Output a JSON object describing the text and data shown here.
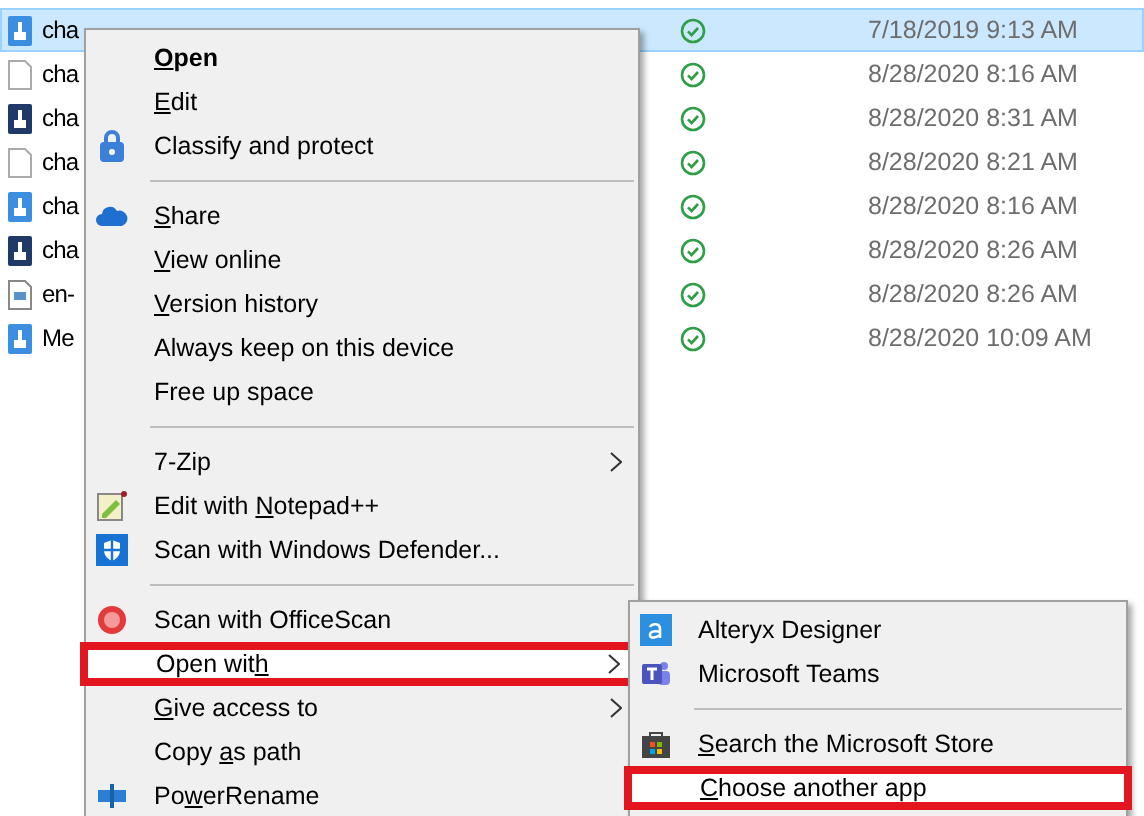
{
  "files": [
    {
      "name": "cha",
      "kind": "bluedoc",
      "synced": true,
      "modified": "7/18/2019 9:13 AM",
      "selected": true
    },
    {
      "name": "cha",
      "kind": "blank",
      "synced": true,
      "modified": "8/28/2020 8:16 AM",
      "selected": false
    },
    {
      "name": "cha",
      "kind": "darkdoc",
      "synced": true,
      "modified": "8/28/2020 8:31 AM",
      "selected": false
    },
    {
      "name": "cha",
      "kind": "blank",
      "synced": true,
      "modified": "8/28/2020 8:21 AM",
      "selected": false
    },
    {
      "name": "cha",
      "kind": "bluedoc",
      "synced": true,
      "modified": "8/28/2020 8:16 AM",
      "selected": false
    },
    {
      "name": "cha",
      "kind": "darkdoc",
      "synced": true,
      "modified": "8/28/2020 8:26 AM",
      "selected": false
    },
    {
      "name": "en-",
      "kind": "textdoc",
      "synced": true,
      "modified": "8/28/2020 8:26 AM",
      "selected": false
    },
    {
      "name": "Me",
      "kind": "bluedoc",
      "synced": true,
      "modified": "8/28/2020 10:09 AM",
      "selected": false
    }
  ],
  "context_menu": [
    {
      "kind": "item",
      "label": "Open",
      "bold": true,
      "selected": false
    },
    {
      "kind": "item",
      "label": "Edit",
      "selected": false
    },
    {
      "kind": "item",
      "label": "Classify and protect",
      "selected": false
    },
    {
      "kind": "separator"
    },
    {
      "kind": "item",
      "label": "Share",
      "selected": false
    },
    {
      "kind": "item",
      "label": "View online",
      "selected": false
    },
    {
      "kind": "item",
      "label": "Version history",
      "selected": false
    },
    {
      "kind": "item",
      "label": "Always keep on this device",
      "selected": false
    },
    {
      "kind": "item",
      "label": "Free up space",
      "selected": false
    },
    {
      "kind": "separator"
    },
    {
      "kind": "item",
      "label": "7-Zip",
      "submenu": true,
      "selected": false
    },
    {
      "kind": "item",
      "label": "Edit with Notepad++",
      "selected": false
    },
    {
      "kind": "item",
      "label": "Scan with Windows Defender...",
      "selected": false
    },
    {
      "kind": "separator"
    },
    {
      "kind": "item",
      "label": "Scan with OfficeScan",
      "selected": false
    },
    {
      "kind": "item",
      "label": "Open with",
      "submenu": true,
      "selected": true
    },
    {
      "kind": "item",
      "label": "Give access to",
      "submenu": true,
      "selected": false
    },
    {
      "kind": "item",
      "label": "Copy as path",
      "selected": false
    },
    {
      "kind": "item",
      "label": "PowerRename",
      "selected": false
    }
  ],
  "open_with_menu": [
    {
      "kind": "item",
      "label": "Alteryx Designer",
      "selected": false
    },
    {
      "kind": "item",
      "label": "Microsoft Teams",
      "selected": false
    },
    {
      "kind": "separator"
    },
    {
      "kind": "item",
      "label": "Search the Microsoft Store",
      "selected": false
    },
    {
      "kind": "item",
      "label": "Choose another app",
      "selected": true
    }
  ]
}
